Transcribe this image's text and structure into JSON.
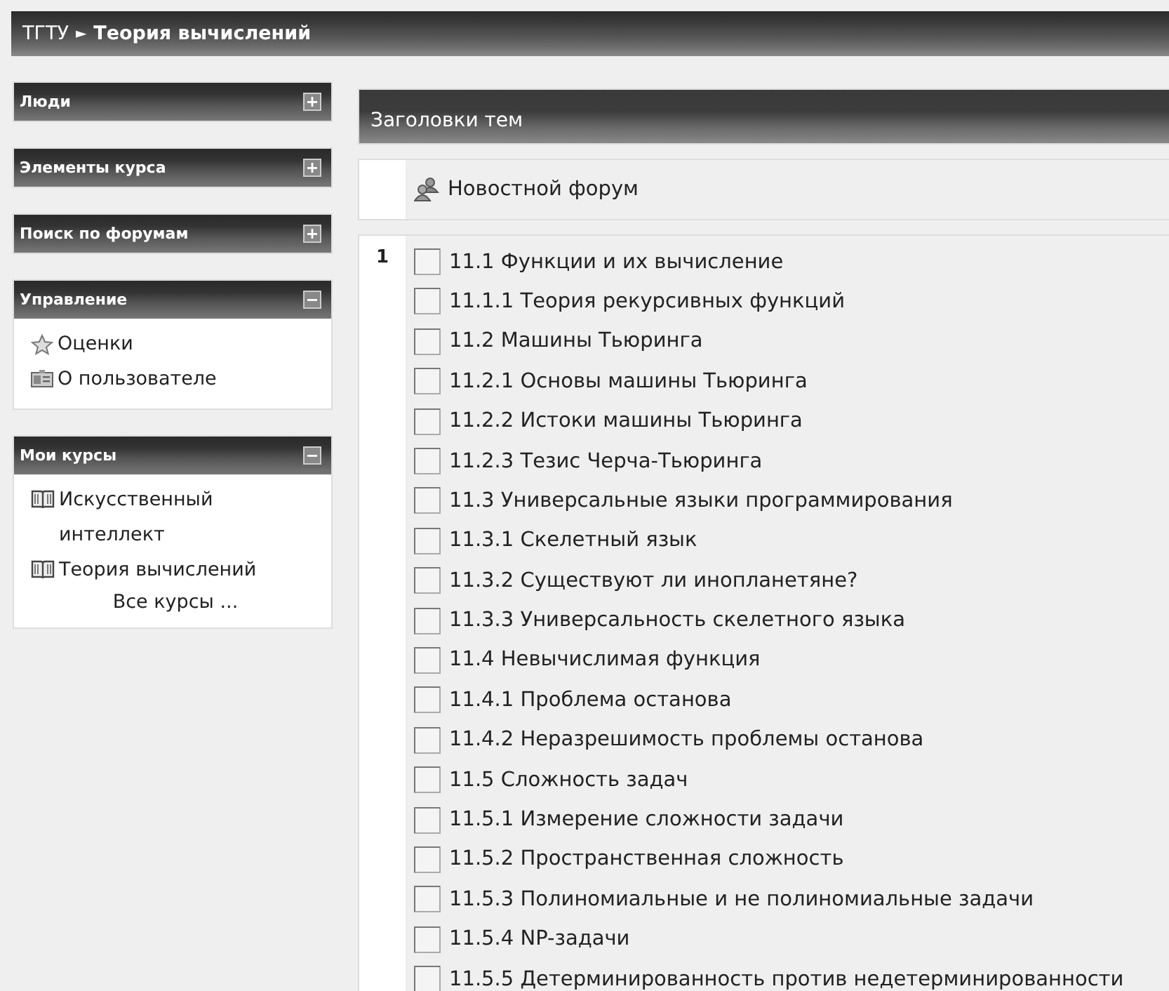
{
  "header": {
    "breadcrumb": [
      {
        "text": "ТГТУ"
      },
      {
        "text": "Теория вычислений"
      }
    ],
    "separator": "►"
  },
  "sidebar": {
    "blocks": [
      {
        "title": "Люди",
        "expanded": false
      },
      {
        "title": "Элементы курса",
        "expanded": false
      },
      {
        "title": "Поиск по форумам",
        "expanded": false
      },
      {
        "title": "Управление",
        "expanded": true,
        "items": [
          {
            "kind": "star",
            "text": "Оценки"
          },
          {
            "kind": "card",
            "text": "О пользователе"
          }
        ]
      },
      {
        "title": "Мои курсы",
        "expanded": true,
        "items": [
          {
            "kind": "book",
            "text": "Искусственный интеллект"
          },
          {
            "kind": "book",
            "text": "Теория вычислений"
          },
          {
            "kind": "link",
            "text": "Все курсы ..."
          }
        ]
      }
    ]
  },
  "main": {
    "title": "Заголовки тем",
    "news": {
      "text": "Новостной форум"
    },
    "sections": [
      {
        "number": "1",
        "items": [
          "11.1 Функции и их вычисление",
          "11.1.1 Теория рекурсивных функций",
          "11.2 Машины Тьюринга",
          "11.2.1 Основы машины Тьюринга",
          "11.2.2 Истоки машины Тьюринга",
          "11.2.3 Тезис Черча-Тьюринга",
          "11.3 Универсальные языки программирования",
          "11.3.1 Скелетный язык",
          "11.3.2 Существуют ли инопланетяне?",
          "11.3.3 Универсальность скелетного языка",
          "11.4 Невычислимая функция",
          "11.4.1 Проблема останова",
          "11.4.2 Неразрешимость проблемы останова",
          "11.5 Сложность задач",
          "11.5.1 Измерение сложности задачи",
          "11.5.2 Пространственная сложность",
          "11.5.3 Полиномиальные и не полиномиальные задачи",
          "11.5.4 NP-задачи",
          "11.5.5 Детерминированность против недетерминированности"
        ]
      }
    ]
  }
}
